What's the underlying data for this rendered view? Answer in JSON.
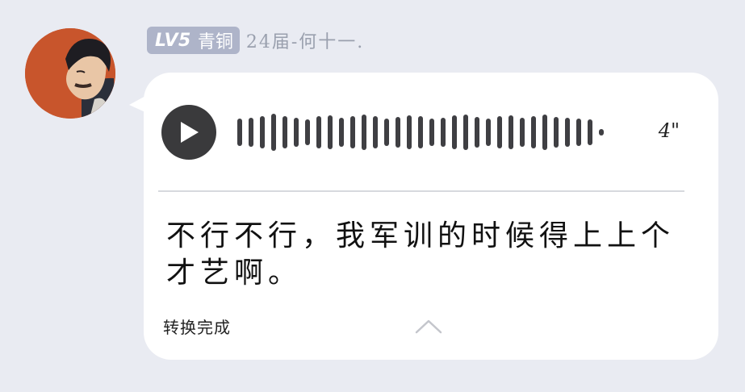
{
  "header": {
    "level": "LV5",
    "rank": "青铜",
    "nickname": "24届-何十一."
  },
  "voice_message": {
    "duration": "4\"",
    "transcript": "不行不行，我军训的时候得上上个才艺啊。",
    "status": "转换完成"
  },
  "colors": {
    "background": "#e9ebf2",
    "badge": "#aeb4c9",
    "bubble": "#ffffff",
    "waveform": "#3f3f43"
  },
  "icons": {
    "play": "play-icon",
    "collapse": "chevron-up-icon"
  }
}
